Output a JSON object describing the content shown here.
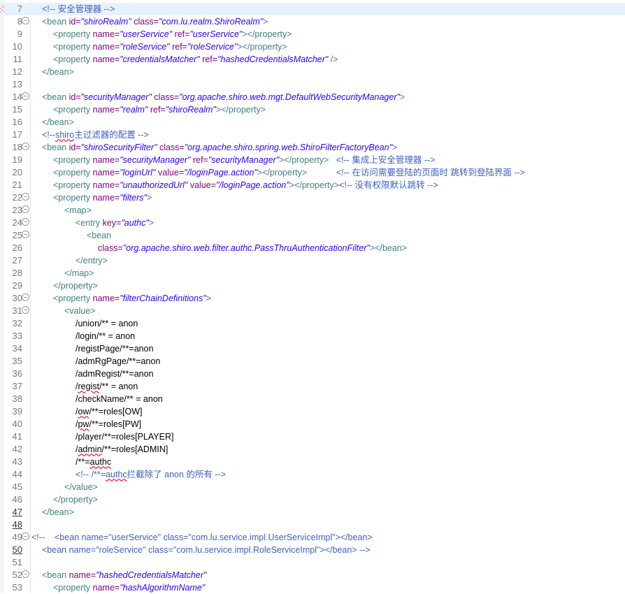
{
  "editor": {
    "lines": [
      {
        "n": "7",
        "fold": false,
        "cur": true,
        "mark": true,
        "ind": 0,
        "segs": [
          [
            "c",
            "<!-- 安全管理器 -->"
          ]
        ]
      },
      {
        "n": "8",
        "fold": true,
        "ind": 0,
        "segs": [
          [
            "t",
            "<bean "
          ],
          [
            "a",
            "id="
          ],
          [
            "v",
            "\"shiroRealm\""
          ],
          [
            "a",
            " class="
          ],
          [
            "v",
            "\"com.lu.realm.ShiroRealm\""
          ],
          [
            "t",
            ">"
          ]
        ]
      },
      {
        "n": "9",
        "ind": 1,
        "segs": [
          [
            "t",
            "<property "
          ],
          [
            "a",
            "name="
          ],
          [
            "v",
            "\"userService\""
          ],
          [
            "a",
            " ref="
          ],
          [
            "v",
            "\"userService\""
          ],
          [
            "t",
            "></property>"
          ]
        ]
      },
      {
        "n": "10",
        "ind": 1,
        "segs": [
          [
            "t",
            "<property "
          ],
          [
            "a",
            "name="
          ],
          [
            "v",
            "\"roleService\""
          ],
          [
            "a",
            " ref="
          ],
          [
            "v",
            "\"roleService\""
          ],
          [
            "t",
            "></property>"
          ]
        ]
      },
      {
        "n": "11",
        "ind": 1,
        "segs": [
          [
            "t",
            "<property "
          ],
          [
            "a",
            "name="
          ],
          [
            "v",
            "\"credentialsMatcher\""
          ],
          [
            "a",
            " ref="
          ],
          [
            "v",
            "\"hashedCredentialsMatcher\""
          ],
          [
            "t",
            " />"
          ]
        ]
      },
      {
        "n": "12",
        "ind": 0,
        "segs": [
          [
            "t",
            "</bean>"
          ]
        ]
      },
      {
        "n": "13",
        "ind": 0,
        "segs": []
      },
      {
        "n": "14",
        "fold": true,
        "ind": 0,
        "segs": [
          [
            "t",
            "<bean "
          ],
          [
            "a",
            "id="
          ],
          [
            "v",
            "\"securityManager\""
          ],
          [
            "a",
            " class="
          ],
          [
            "v",
            "\"org.apache.shiro.web.mgt.DefaultWebSecurityManager\""
          ],
          [
            "t",
            ">"
          ]
        ]
      },
      {
        "n": "15",
        "ind": 1,
        "segs": [
          [
            "t",
            "<property "
          ],
          [
            "a",
            "name="
          ],
          [
            "v",
            "\"realm\""
          ],
          [
            "a",
            " ref="
          ],
          [
            "v",
            "\"shiroRealm\""
          ],
          [
            "t",
            "></property>"
          ]
        ]
      },
      {
        "n": "16",
        "ind": 0,
        "segs": [
          [
            "t",
            "</bean>"
          ]
        ]
      },
      {
        "n": "17",
        "ind": 0,
        "segs": [
          [
            "c",
            "<!--"
          ],
          [
            "c sq",
            "shiro"
          ],
          [
            "c",
            "主过滤器的配置 -->"
          ]
        ]
      },
      {
        "n": "18",
        "fold": true,
        "ind": 0,
        "segs": [
          [
            "t",
            "<bean "
          ],
          [
            "a",
            "id="
          ],
          [
            "v",
            "\"shiroSecurityFilter\""
          ],
          [
            "a",
            " class="
          ],
          [
            "v",
            "\"org.apache.shiro.spring.web.ShiroFilterFactoryBean\""
          ],
          [
            "t",
            ">"
          ]
        ]
      },
      {
        "n": "19",
        "ind": 1,
        "segs": [
          [
            "t",
            "<property "
          ],
          [
            "a",
            "name="
          ],
          [
            "v",
            "\"securityManager\""
          ],
          [
            "a",
            " ref="
          ],
          [
            "v",
            "\"securityManager\""
          ],
          [
            "t",
            "></property>"
          ],
          [
            "x",
            "   "
          ],
          [
            "c",
            "<!-- 集成上安全管理器 -->"
          ]
        ]
      },
      {
        "n": "20",
        "ind": 1,
        "segs": [
          [
            "t",
            "<property "
          ],
          [
            "a",
            "name="
          ],
          [
            "v",
            "\"loginUrl\""
          ],
          [
            "a",
            " value="
          ],
          [
            "v",
            "\"/loginPage.action\""
          ],
          [
            "t",
            "></property>"
          ],
          [
            "x",
            "            "
          ],
          [
            "c",
            "<!-- 在访问需要登陆的页面时 跳转到登陆界面 -->"
          ]
        ]
      },
      {
        "n": "21",
        "ind": 1,
        "segs": [
          [
            "t",
            "<property "
          ],
          [
            "a",
            "name="
          ],
          [
            "v",
            "\"unauthorizedUrl\""
          ],
          [
            "a",
            " value="
          ],
          [
            "v",
            "\"/loginPage.action\""
          ],
          [
            "t",
            "></property>"
          ],
          [
            "c",
            "<!-- 没有权限默认跳转 -->"
          ]
        ]
      },
      {
        "n": "22",
        "fold": true,
        "ind": 1,
        "segs": [
          [
            "t",
            "<property "
          ],
          [
            "a",
            "name="
          ],
          [
            "v",
            "\"filters\""
          ],
          [
            "t",
            ">"
          ]
        ]
      },
      {
        "n": "23",
        "fold": true,
        "ind": 2,
        "segs": [
          [
            "t",
            "<map>"
          ]
        ]
      },
      {
        "n": "24",
        "fold": true,
        "ind": 3,
        "segs": [
          [
            "t",
            "<entry "
          ],
          [
            "a",
            "key="
          ],
          [
            "v",
            "\"authc\""
          ],
          [
            "t",
            ">"
          ]
        ]
      },
      {
        "n": "25",
        "fold": true,
        "ind": 4,
        "segs": [
          [
            "t",
            "<bean"
          ]
        ]
      },
      {
        "n": "26",
        "ind": 5,
        "segs": [
          [
            "a",
            "class="
          ],
          [
            "v",
            "\"org.apache.shiro.web.filter.authc.PassThruAuthenticationFilter\""
          ],
          [
            "t",
            "></bean>"
          ]
        ]
      },
      {
        "n": "27",
        "ind": 3,
        "segs": [
          [
            "t",
            "</entry>"
          ]
        ]
      },
      {
        "n": "28",
        "ind": 2,
        "segs": [
          [
            "t",
            "</map>"
          ]
        ]
      },
      {
        "n": "29",
        "ind": 1,
        "segs": [
          [
            "t",
            "</property>"
          ]
        ]
      },
      {
        "n": "30",
        "fold": true,
        "ind": 1,
        "segs": [
          [
            "t",
            "<property "
          ],
          [
            "a",
            "name="
          ],
          [
            "v",
            "\"filterChainDefinitions\""
          ],
          [
            "t",
            ">"
          ]
        ]
      },
      {
        "n": "31",
        "fold": true,
        "ind": 2,
        "segs": [
          [
            "t",
            "<value>"
          ]
        ]
      },
      {
        "n": "32",
        "ind": 3,
        "segs": [
          [
            "x",
            "/union/** = anon"
          ]
        ]
      },
      {
        "n": "33",
        "ind": 3,
        "segs": [
          [
            "x",
            "/login/** = anon"
          ]
        ]
      },
      {
        "n": "34",
        "ind": 3,
        "segs": [
          [
            "x",
            "/registPage/**=anon"
          ]
        ]
      },
      {
        "n": "35",
        "ind": 3,
        "segs": [
          [
            "x",
            "/admRgPage/**=anon"
          ]
        ]
      },
      {
        "n": "36",
        "ind": 3,
        "segs": [
          [
            "x",
            "/admRegist/**=anon"
          ]
        ]
      },
      {
        "n": "37",
        "ind": 3,
        "segs": [
          [
            "x",
            "/"
          ],
          [
            "x sq",
            "regist"
          ],
          [
            "x",
            "/** = anon"
          ]
        ]
      },
      {
        "n": "38",
        "ind": 3,
        "segs": [
          [
            "x",
            "/checkName/** = anon"
          ]
        ]
      },
      {
        "n": "39",
        "ind": 3,
        "segs": [
          [
            "x",
            "/"
          ],
          [
            "x sq",
            "ow"
          ],
          [
            "x",
            "/**=roles[OW]"
          ]
        ]
      },
      {
        "n": "40",
        "ind": 3,
        "segs": [
          [
            "x",
            "/"
          ],
          [
            "x sq",
            "pw"
          ],
          [
            "x",
            "/**=roles[PW]"
          ]
        ]
      },
      {
        "n": "41",
        "ind": 3,
        "segs": [
          [
            "x",
            "/player/**=roles[PLAYER]"
          ]
        ]
      },
      {
        "n": "42",
        "ind": 3,
        "segs": [
          [
            "x",
            "/"
          ],
          [
            "x sq",
            "admin"
          ],
          [
            "x",
            "/**=roles[ADMIN]"
          ]
        ]
      },
      {
        "n": "43",
        "ind": 3,
        "segs": [
          [
            "x",
            "/**="
          ],
          [
            "x sq",
            "authc"
          ]
        ]
      },
      {
        "n": "44",
        "ind": 3,
        "segs": [
          [
            "c",
            "<!-- /**="
          ],
          [
            "c sq",
            "authc"
          ],
          [
            "c",
            "拦截除了 anon 的所有 -->"
          ]
        ]
      },
      {
        "n": "45",
        "ind": 2,
        "segs": [
          [
            "t",
            "</value>"
          ]
        ]
      },
      {
        "n": "46",
        "ind": 1,
        "segs": [
          [
            "t",
            "</property>"
          ]
        ]
      },
      {
        "n": "47",
        "ul": true,
        "ind": 0,
        "segs": [
          [
            "t",
            "</bean>"
          ]
        ]
      },
      {
        "n": "48",
        "ul": true,
        "ind": 0,
        "segs": []
      },
      {
        "n": "49",
        "fold": true,
        "ind": -1,
        "segs": [
          [
            "c",
            "<!--    <bean name=\"userService\" class=\"com.lu.service.impl.UserServiceImpl\"></bean>"
          ]
        ]
      },
      {
        "n": "50",
        "ul": true,
        "ind": 0,
        "segs": [
          [
            "c",
            "<bean name=\"roleService\" class=\"com.lu.service.impl.RoleServiceImpl\"></bean> -->"
          ]
        ]
      },
      {
        "n": "51",
        "ind": 0,
        "segs": []
      },
      {
        "n": "52",
        "fold": true,
        "ind": 0,
        "segs": [
          [
            "t",
            "<bean "
          ],
          [
            "a",
            "name="
          ],
          [
            "v",
            "\"hashedCredentialsMatcher\""
          ]
        ]
      },
      {
        "n": "53",
        "ind": 1,
        "segs": [
          [
            "t",
            "<property "
          ],
          [
            "a",
            "name="
          ],
          [
            "v",
            "\"hashAlgorithmName\""
          ]
        ]
      }
    ]
  }
}
